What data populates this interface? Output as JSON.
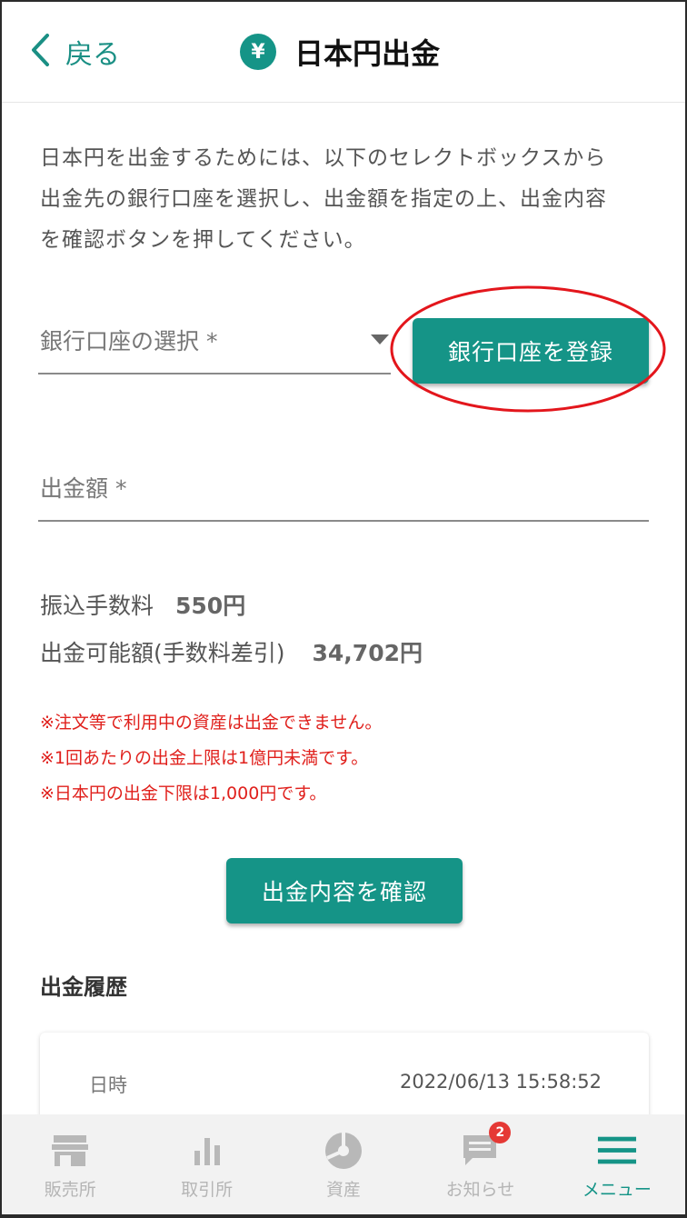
{
  "header": {
    "back_label": "戻る",
    "currency_symbol": "¥",
    "title": "日本円出金"
  },
  "intro": {
    "line1": "日本円を出金するためには、以下のセレクトボックスから",
    "line2": "出金先の銀行口座を選択し、出金額を指定の上、出金内容",
    "line3": "を確認ボタンを押してください。"
  },
  "form": {
    "bank_select_placeholder": "銀行口座の選択 *",
    "register_button": "銀行口座を登録",
    "amount_placeholder": "出金額 *"
  },
  "fees": {
    "transfer_fee_label": "振込手数料",
    "transfer_fee_value": "550円",
    "available_label": "出金可能額(手数料差引)",
    "available_value": "34,702円"
  },
  "notes": [
    "※注文等で利用中の資産は出金できません。",
    "※1回あたりの出金上限は1億円未満です。",
    "※日本円の出金下限は1,000円です。"
  ],
  "confirm_button": "出金内容を確認",
  "history": {
    "title": "出金履歴",
    "date_label": "日時",
    "date_value": "2022/06/13 15:58:52"
  },
  "bottom_nav": {
    "items": [
      {
        "label": "販売所",
        "icon": "store-icon"
      },
      {
        "label": "取引所",
        "icon": "bar-chart-icon"
      },
      {
        "label": "資産",
        "icon": "pie-chart-icon"
      },
      {
        "label": "お知らせ",
        "icon": "message-icon",
        "badge": "2"
      },
      {
        "label": "メニュー",
        "icon": "hamburger-menu-icon"
      }
    ],
    "active_index": 4
  },
  "colors": {
    "accent": "#159487",
    "warning": "#e0201c",
    "highlight_ring": "#e3161c",
    "badge": "#e53935"
  }
}
